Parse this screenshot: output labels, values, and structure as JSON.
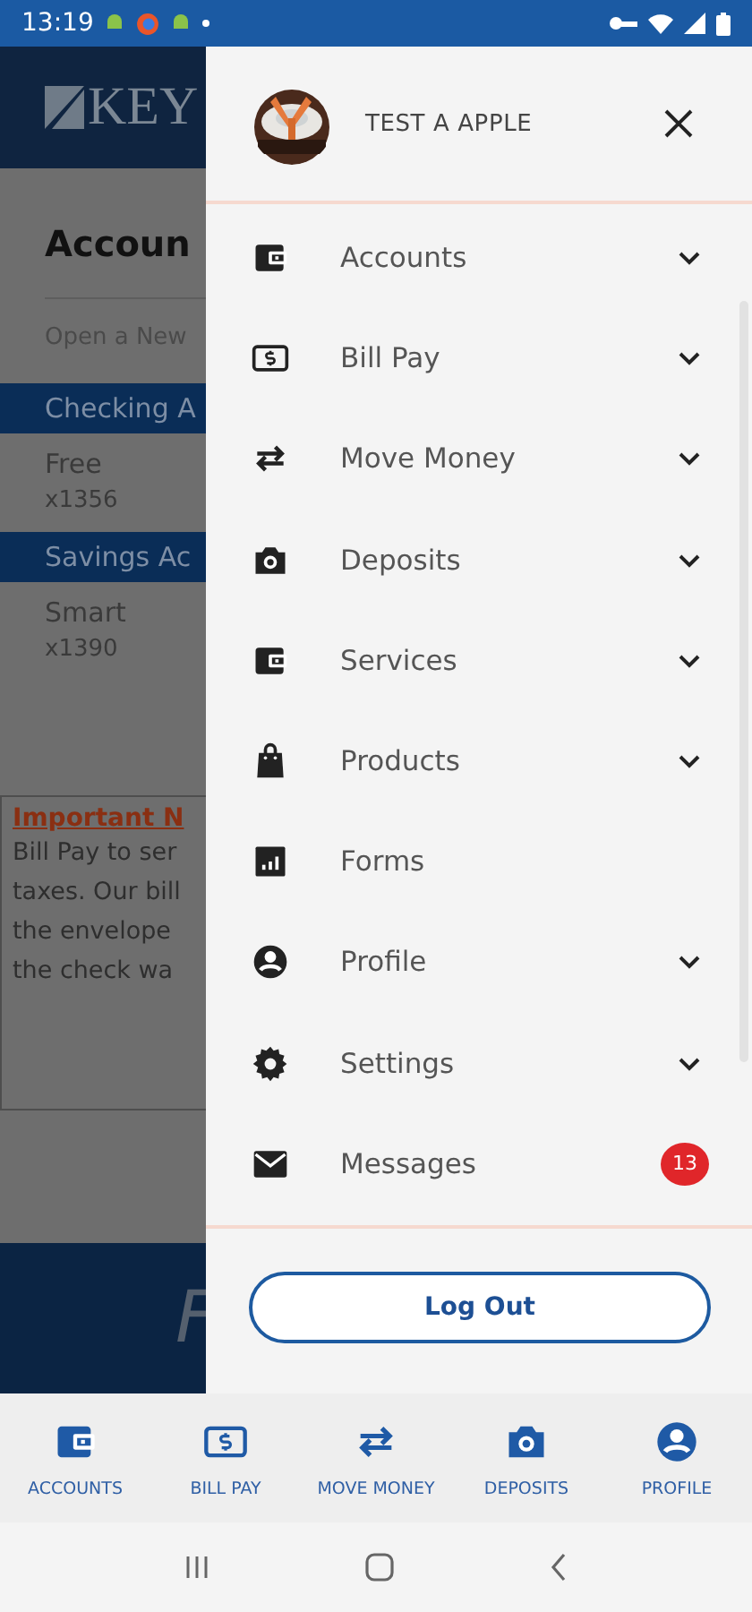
{
  "status_bar": {
    "time": "13:19"
  },
  "background_page": {
    "logo": "KEY",
    "title": "Accoun",
    "link": "Open a New",
    "sections": [
      {
        "header": "Checking A",
        "accounts": [
          {
            "name": "Free",
            "number": "x1356"
          }
        ]
      },
      {
        "header": "Savings Ac",
        "accounts": [
          {
            "name": "Smart",
            "number": "x1390"
          }
        ]
      }
    ],
    "notice": {
      "title": "Important N",
      "lines": [
        "Bill Pay to ser",
        "taxes. Our bill",
        "the envelope",
        "the check wa"
      ]
    },
    "footer_text": "F"
  },
  "drawer": {
    "user_name": "TEST A APPLE",
    "items": [
      {
        "label": "Accounts",
        "kind": "wallet",
        "expandable": true
      },
      {
        "label": "Bill Pay",
        "kind": "bill",
        "expandable": true
      },
      {
        "label": "Move Money",
        "kind": "transfer",
        "expandable": true
      },
      {
        "label": "Deposits",
        "kind": "camera",
        "expandable": true
      },
      {
        "label": "Services",
        "kind": "wallet",
        "expandable": true
      },
      {
        "label": "Products",
        "kind": "bag",
        "expandable": true
      },
      {
        "label": "Forms",
        "kind": "chart",
        "expandable": false
      },
      {
        "label": "Profile",
        "kind": "person",
        "expandable": true
      },
      {
        "label": "Settings",
        "kind": "gear",
        "expandable": true
      },
      {
        "label": "Messages",
        "kind": "mail",
        "expandable": false,
        "badge": "13"
      }
    ],
    "logout": "Log Out"
  },
  "bottom_nav": [
    {
      "label": "ACCOUNTS",
      "kind": "wallet"
    },
    {
      "label": "BILL PAY",
      "kind": "bill"
    },
    {
      "label": "MOVE MONEY",
      "kind": "transfer"
    },
    {
      "label": "DEPOSITS",
      "kind": "camera"
    },
    {
      "label": "PROFILE",
      "kind": "person"
    }
  ]
}
